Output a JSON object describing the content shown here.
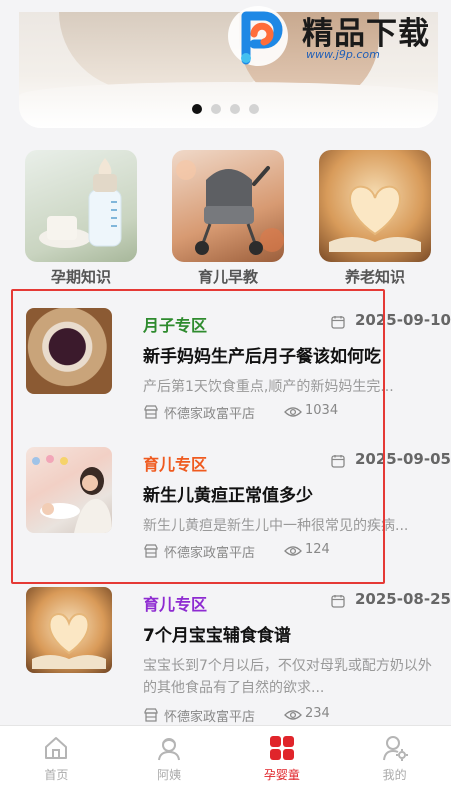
{
  "banner": {
    "dots": 4,
    "active_index": 0
  },
  "watermark": {
    "title": "精品下载",
    "url": "www.j9p.com"
  },
  "categories": [
    {
      "label": "孕期知识",
      "icon": "bottle-image"
    },
    {
      "label": "育儿早教",
      "icon": "stroller-image"
    },
    {
      "label": "养老知识",
      "icon": "heart-book-image"
    }
  ],
  "articles": [
    {
      "tag": "月子专区",
      "tag_color": "#2e8b2e",
      "date": "2025-09-10",
      "title": "新手妈妈生产后月子餐该如何吃",
      "desc": "产后第1天饮食重点,顺产的新妈妈生完...",
      "store": "怀德家政富平店",
      "views": "1034"
    },
    {
      "tag": "育儿专区",
      "tag_color": "#ef5a1f",
      "date": "2025-09-05",
      "title": "新生儿黄疸正常值多少",
      "desc": "新生儿黄疸是新生儿中一种很常见的疾病...",
      "store": "怀德家政富平店",
      "views": "124"
    },
    {
      "tag": "育儿专区",
      "tag_color": "#8e2bd1",
      "date": "2025-08-25",
      "title": "7个月宝宝辅食食谱",
      "desc": "宝宝长到7个月以后，不仅对母乳或配方奶以外的其他食品有了自然的欲求...",
      "store": "怀德家政富平店",
      "views": "234"
    }
  ],
  "tabbar": [
    {
      "label": "首页",
      "icon": "home-icon",
      "active": false
    },
    {
      "label": "阿姨",
      "icon": "nanny-icon",
      "active": false
    },
    {
      "label": "孕婴童",
      "icon": "grid-icon",
      "active": true
    },
    {
      "label": "我的",
      "icon": "user-settings-icon",
      "active": false
    }
  ],
  "colors": {
    "accent": "#e0252b",
    "highlight_border": "#e53935"
  }
}
